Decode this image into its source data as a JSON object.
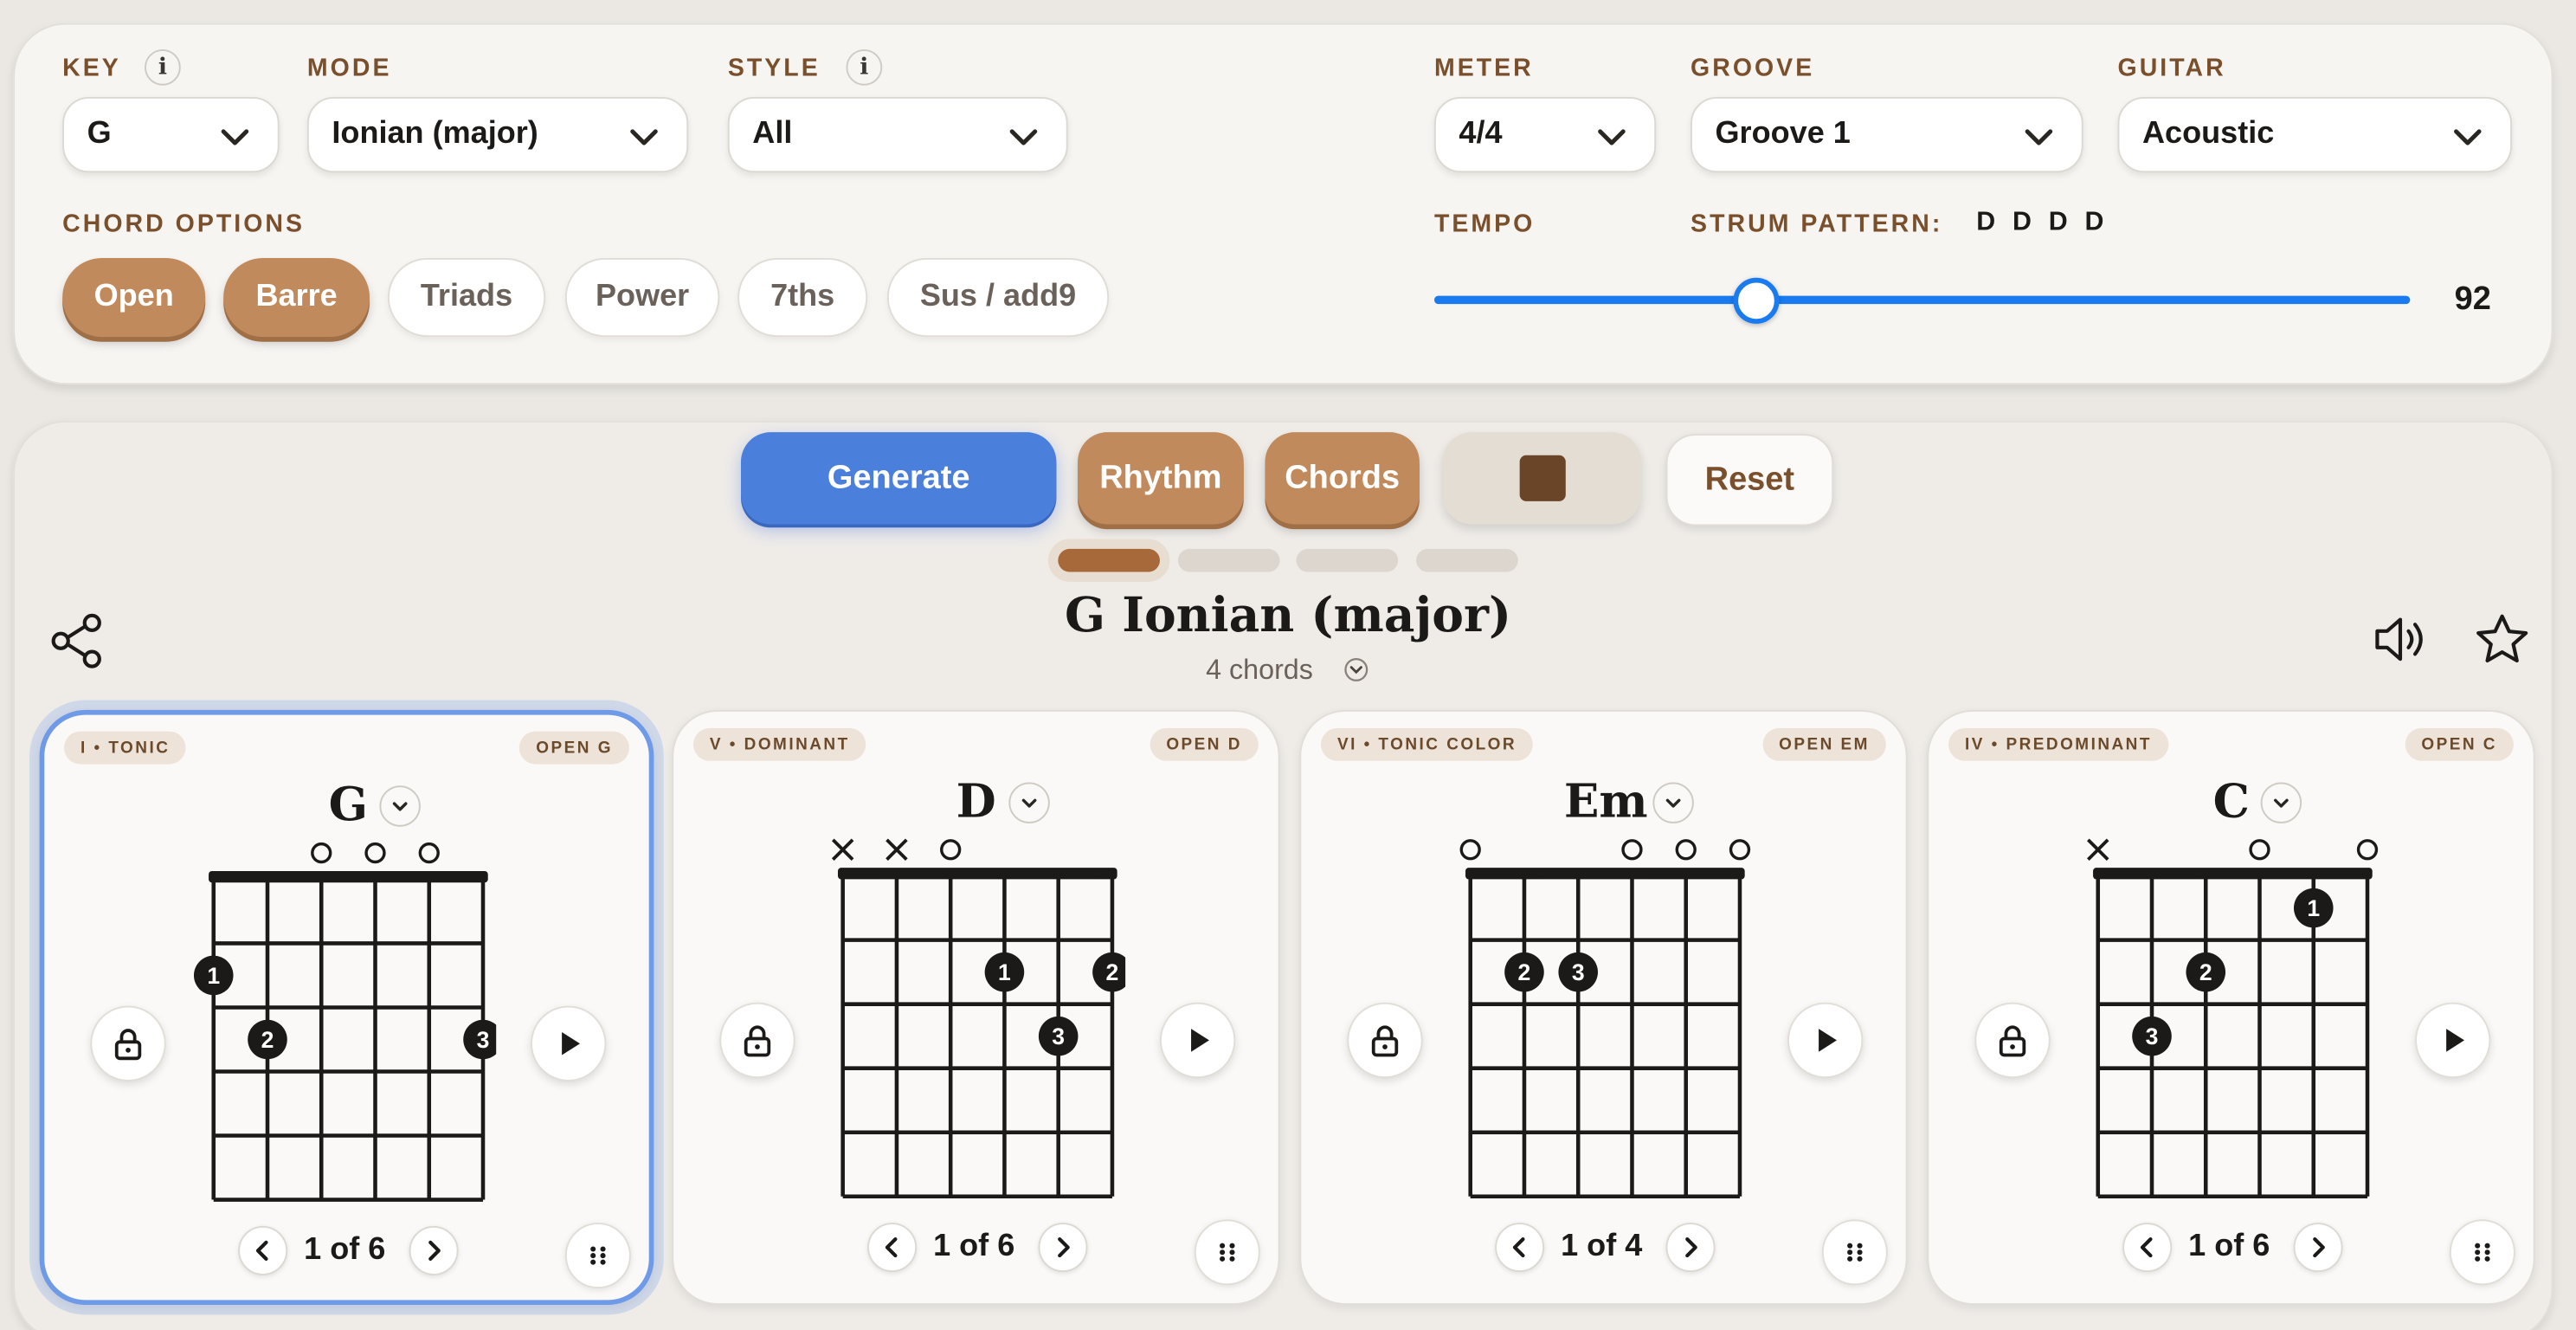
{
  "settings": {
    "key": {
      "label": "KEY",
      "value": "G"
    },
    "mode": {
      "label": "MODE",
      "value": "Ionian (major)"
    },
    "style": {
      "label": "STYLE",
      "value": "All"
    },
    "meter": {
      "label": "METER",
      "value": "4/4"
    },
    "groove": {
      "label": "GROOVE",
      "value": "Groove 1"
    },
    "guitar": {
      "label": "GUITAR",
      "value": "Acoustic"
    },
    "chord_options": {
      "label": "CHORD OPTIONS",
      "items": [
        {
          "label": "Open",
          "active": true
        },
        {
          "label": "Barre",
          "active": true
        },
        {
          "label": "Triads",
          "active": false
        },
        {
          "label": "Power",
          "active": false
        },
        {
          "label": "7ths",
          "active": false
        },
        {
          "label": "Sus / add9",
          "active": false
        }
      ]
    },
    "tempo": {
      "label": "TEMPO",
      "value": 92,
      "fraction": 0.33
    },
    "strum": {
      "label": "STRUM PATTERN:",
      "value": "D D D D"
    },
    "info_glyph": "i"
  },
  "actions": {
    "generate": "Generate",
    "rhythm": "Rhythm",
    "chords": "Chords",
    "reset": "Reset"
  },
  "progression": {
    "title": "G Ionian (major)",
    "subtitle": "4 chords",
    "active_dot": 0,
    "dot_count": 4
  },
  "cards": [
    {
      "function": "I • TONIC",
      "voicing": "OPEN G",
      "name": "G",
      "variant": "1 of 6",
      "selected": true,
      "strings": [
        "fingered",
        "fingered",
        "open",
        "open",
        "open",
        "fingered"
      ],
      "dots": [
        {
          "fret": 2,
          "string": 6,
          "finger": "1"
        },
        {
          "fret": 3,
          "string": 5,
          "finger": "2"
        },
        {
          "fret": 3,
          "string": 1,
          "finger": "3"
        }
      ]
    },
    {
      "function": "V • DOMINANT",
      "voicing": "OPEN D",
      "name": "D",
      "variant": "1 of 6",
      "selected": false,
      "strings": [
        "muted",
        "muted",
        "open",
        "fingered",
        "fingered",
        "fingered"
      ],
      "dots": [
        {
          "fret": 2,
          "string": 3,
          "finger": "1"
        },
        {
          "fret": 2,
          "string": 1,
          "finger": "2"
        },
        {
          "fret": 3,
          "string": 2,
          "finger": "3"
        }
      ]
    },
    {
      "function": "VI • TONIC COLOR",
      "voicing": "OPEN EM",
      "name": "Em",
      "variant": "1 of 4",
      "selected": false,
      "strings": [
        "open",
        "fingered",
        "fingered",
        "open",
        "open",
        "open"
      ],
      "dots": [
        {
          "fret": 2,
          "string": 5,
          "finger": "2"
        },
        {
          "fret": 2,
          "string": 4,
          "finger": "3"
        }
      ]
    },
    {
      "function": "IV • PREDOMINANT",
      "voicing": "OPEN C",
      "name": "C",
      "variant": "1 of 6",
      "selected": false,
      "strings": [
        "muted",
        "fingered",
        "fingered",
        "open",
        "fingered",
        "open"
      ],
      "dots": [
        {
          "fret": 1,
          "string": 2,
          "finger": "1"
        },
        {
          "fret": 2,
          "string": 4,
          "finger": "2"
        },
        {
          "fret": 3,
          "string": 5,
          "finger": "3"
        }
      ]
    }
  ],
  "icons": {
    "share": "share-icon",
    "sound": "speaker-icon",
    "favorite": "star-icon",
    "lock": "lock-icon",
    "play": "play-icon",
    "grip": "grip-icon",
    "prev": "chevron-left-icon",
    "next": "chevron-right-icon",
    "stop": "stop-icon"
  },
  "colors": {
    "accent_brown": "#c08a5c",
    "label_brown": "#7a4f2c",
    "generate_blue": "#4a7fdc",
    "slider_blue": "#1a7bf0",
    "selected_border": "#6f9ae8"
  }
}
